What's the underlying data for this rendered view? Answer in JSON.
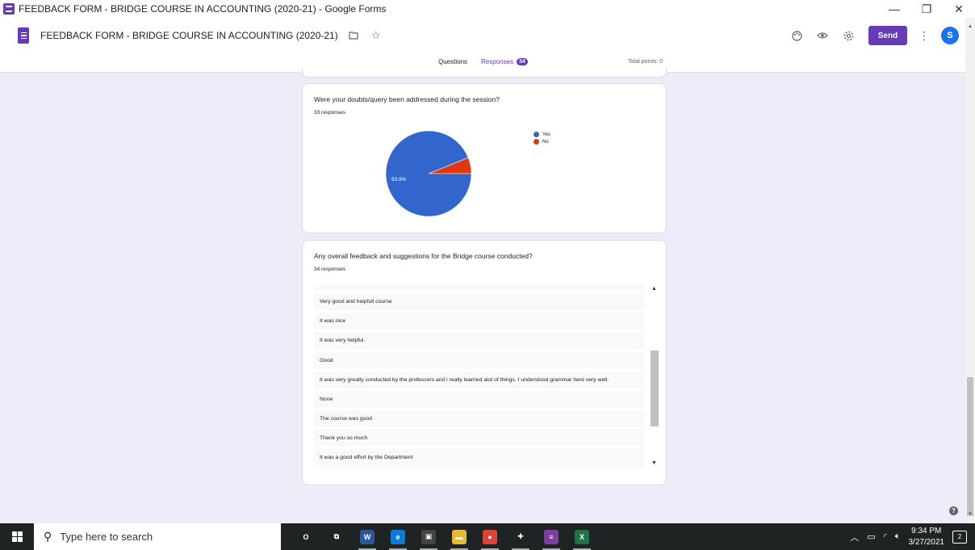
{
  "window": {
    "title": "FEEDBACK FORM - BRIDGE COURSE IN ACCOUNTING (2020-21) - Google Forms",
    "minimize": "—",
    "restore": "❐",
    "close": "✕"
  },
  "header": {
    "form_title": "FEEDBACK FORM - BRIDGE COURSE IN ACCOUNTING (2020-21)",
    "send_label": "Send",
    "avatar_letter": "S",
    "icons": [
      "folder-icon",
      "star-icon",
      "palette-icon",
      "eye-icon",
      "gear-icon",
      "more-vert-icon"
    ]
  },
  "tabs": {
    "questions": "Questions",
    "responses": "Responses",
    "responses_count": "34",
    "total_points": "Total points: 0"
  },
  "question1": {
    "title": "Were your doubts/query been addressed during the session?",
    "count": "33 responses",
    "pie_label": "93.9%",
    "legend": [
      {
        "label": "Yes",
        "color": "#3366cc"
      },
      {
        "label": "No",
        "color": "#dc3912"
      }
    ]
  },
  "question2": {
    "title": "Any overall feedback and suggestions for the Bridge course conducted?",
    "count": "34 responses",
    "responses": [
      "Very good and helpfull course",
      "It was nice",
      "It was very helpful.",
      "Good",
      "It was very greatly conducted by the professors and i really learned alot of things. I understood grammar here very well.",
      "None",
      "The course was good",
      "Thank you so much",
      "It was a good effort by the Department"
    ]
  },
  "chart_data": {
    "type": "pie",
    "title": "Were your doubts/query been addressed during the session?",
    "categories": [
      "Yes",
      "No"
    ],
    "values": [
      93.9,
      6.1
    ],
    "colors": [
      "#3366cc",
      "#dc3912"
    ],
    "legend_position": "right"
  },
  "taskbar": {
    "search_placeholder": "Type here to search",
    "time": "9:34 PM",
    "date": "3/27/2021",
    "notification_count": "2",
    "apps": [
      {
        "name": "cortana-icon",
        "label": "O",
        "color": "#1f2324"
      },
      {
        "name": "task-view-icon",
        "label": "⧉",
        "color": "#1f2324"
      },
      {
        "name": "word-icon",
        "label": "W",
        "color": "#2b579a"
      },
      {
        "name": "edge-icon",
        "label": "e",
        "color": "#0f7bd8"
      },
      {
        "name": "store-icon",
        "label": "▣",
        "color": "#444"
      },
      {
        "name": "file-explorer-icon",
        "label": "▬",
        "color": "#e8b83a"
      },
      {
        "name": "chrome-icon",
        "label": "●",
        "color": "#db4437"
      },
      {
        "name": "new-app-icon",
        "label": "✚",
        "color": "#1f2324"
      },
      {
        "name": "winrar-icon",
        "label": "≡",
        "color": "#7b3fa0"
      },
      {
        "name": "excel-icon",
        "label": "X",
        "color": "#217346"
      }
    ]
  }
}
